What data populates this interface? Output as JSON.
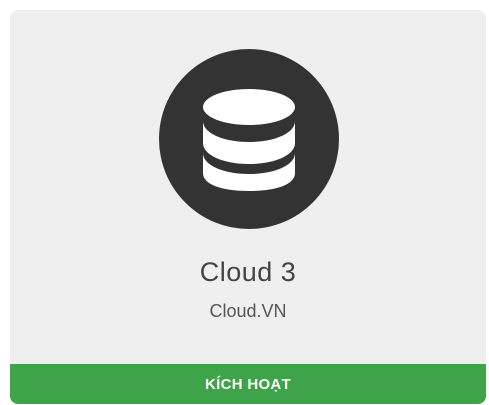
{
  "card": {
    "icon": "database-icon",
    "icon_bg_color": "#333333",
    "title": "Cloud 3",
    "subtitle": "Cloud.VN",
    "button_label": "KÍCH HOẠT",
    "button_color": "#3fa34a"
  }
}
